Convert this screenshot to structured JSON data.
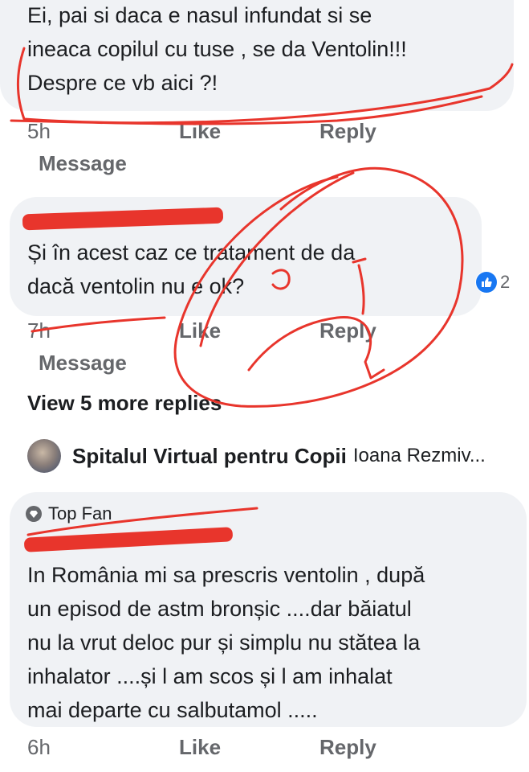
{
  "comments": [
    {
      "text": "Ei, pai si daca e nasul infundat si se\nineaca copilul cu tuse , se da Ventolin!!!\nDespre ce vb aici ?!",
      "time": "5h",
      "like_label": "Like",
      "reply_label": "Reply",
      "message_label": "Message"
    },
    {
      "text": "Și în acest caz ce tratament de da\ndacă ventolin nu e ok?",
      "reaction_count": "2",
      "time": "7h",
      "like_label": "Like",
      "reply_label": "Reply",
      "message_label": "Message"
    },
    {
      "badge": "Top Fan",
      "text": "In România mi sa prescris ventolin , după\nun episod de astm bronșic ....dar băiatul\nnu la vrut deloc pur și simplu nu stătea la\ninhalator ....și l am scos și l am inhalat\nmai departe cu salbutamol .....",
      "time": "6h",
      "like_label": "Like",
      "reply_label": "Reply"
    }
  ],
  "view_more": "View 5 more replies",
  "page_reply": {
    "author": "Spitalul Virtual pentru Copii",
    "preview": "Ioana Rezmiv..."
  },
  "colors": {
    "bubble": "#f0f2f5",
    "secondary_text": "#65676b",
    "annotation": "#e8352c",
    "like_blue": "#1877f2"
  }
}
